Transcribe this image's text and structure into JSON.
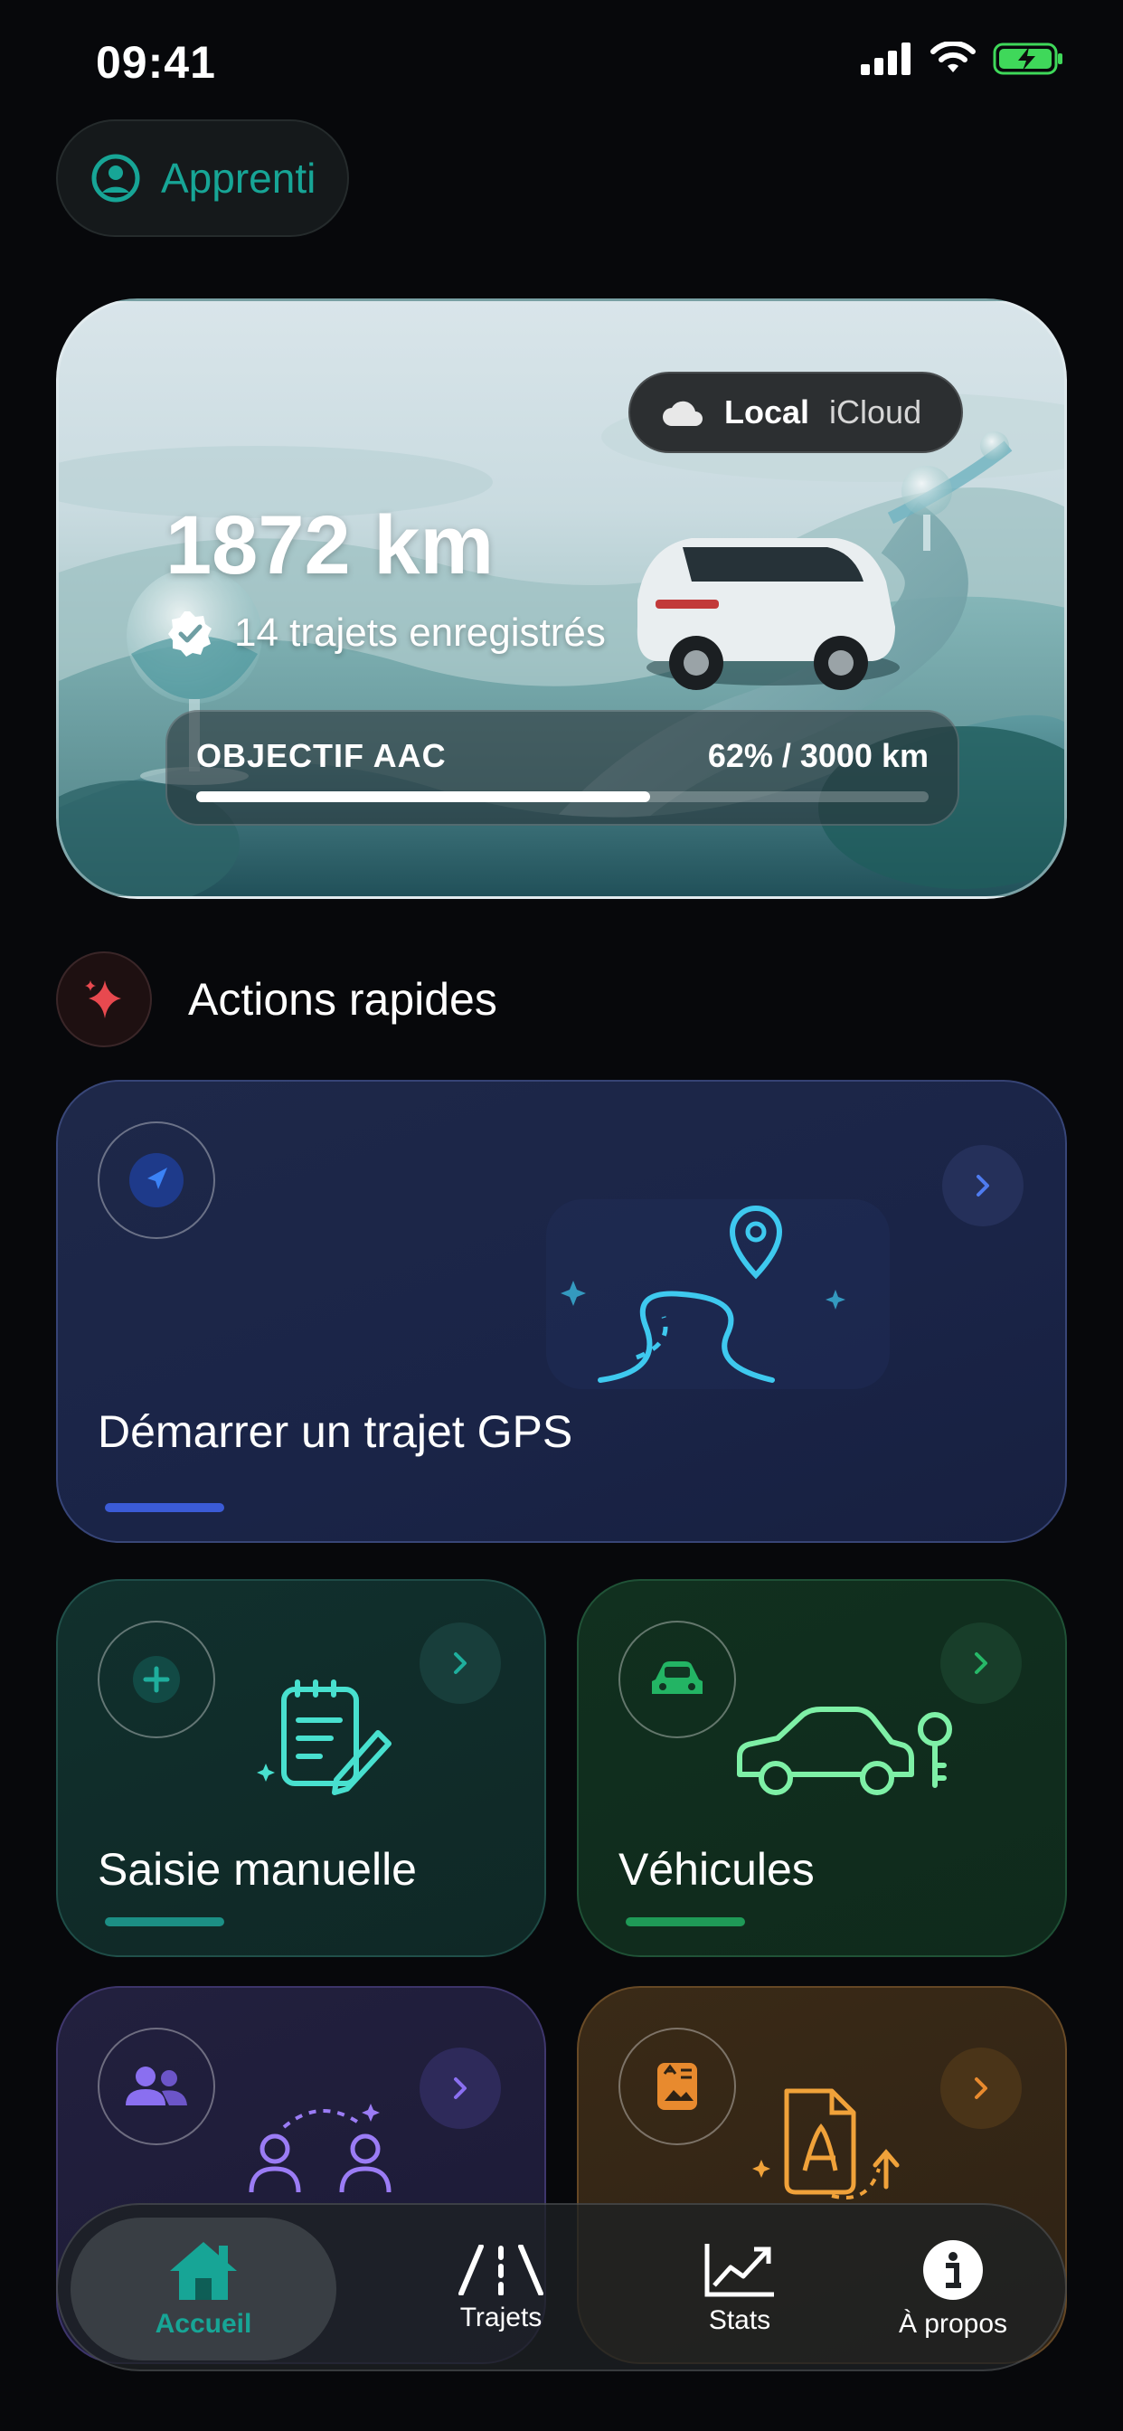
{
  "status_bar": {
    "time": "09:41"
  },
  "profile": {
    "label": "Apprenti"
  },
  "hero": {
    "storage_options": [
      "Local",
      "iCloud"
    ],
    "storage_selected": "Local",
    "distance": "1872 km",
    "trips_text": "14 trajets enregistrés",
    "goal": {
      "label": "OBJECTIF AAC",
      "value_text": "62% / 3000 km",
      "progress_fraction": 0.62
    }
  },
  "quick_actions": {
    "title": "Actions rapides",
    "cards": [
      {
        "title": "Démarrer un trajet GPS",
        "accent": "#3b5bd6"
      },
      {
        "title": "Saisie manuelle",
        "accent": "#1c8f85"
      },
      {
        "title": "Véhicules",
        "accent": "#1f9a57"
      }
    ]
  },
  "tab_bar": {
    "items": [
      {
        "label": "Accueil",
        "icon": "home-icon",
        "active": true
      },
      {
        "label": "Trajets",
        "icon": "road-icon",
        "active": false
      },
      {
        "label": "Stats",
        "icon": "chart-icon",
        "active": false
      },
      {
        "label": "À propos",
        "icon": "info-icon",
        "active": false
      }
    ]
  },
  "colors": {
    "accent_teal": "#17a596",
    "background": "#07080b"
  }
}
